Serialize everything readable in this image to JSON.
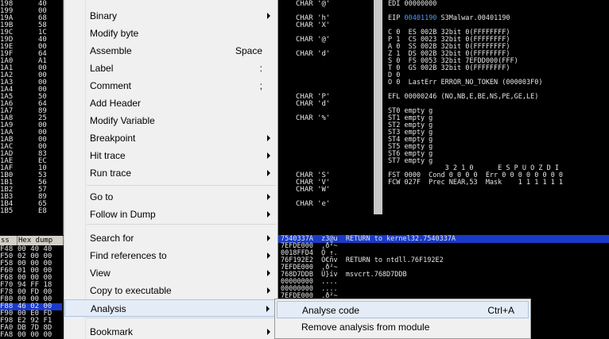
{
  "left_pane": {
    "rows": [
      {
        "addr": "198",
        "val": "40"
      },
      {
        "addr": "199",
        "val": "00"
      },
      {
        "addr": "19A",
        "val": "68"
      },
      {
        "addr": "19B",
        "val": "58"
      },
      {
        "addr": "19C",
        "val": "1C"
      },
      {
        "addr": "19D",
        "val": "40"
      },
      {
        "addr": "19E",
        "val": "00"
      },
      {
        "addr": "19F",
        "val": "64"
      },
      {
        "addr": "1A0",
        "val": "A1"
      },
      {
        "addr": "1A1",
        "val": "00"
      },
      {
        "addr": "1A2",
        "val": "00"
      },
      {
        "addr": "1A3",
        "val": "00"
      },
      {
        "addr": "1A4",
        "val": "00"
      },
      {
        "addr": "1A5",
        "val": "50"
      },
      {
        "addr": "1A6",
        "val": "64"
      },
      {
        "addr": "1A7",
        "val": "89"
      },
      {
        "addr": "1A8",
        "val": "25"
      },
      {
        "addr": "1A9",
        "val": "00"
      },
      {
        "addr": "1AA",
        "val": "00"
      },
      {
        "addr": "1AB",
        "val": "00"
      },
      {
        "addr": "1AC",
        "val": "00"
      },
      {
        "addr": "1AD",
        "val": "83"
      },
      {
        "addr": "1AE",
        "val": "EC"
      },
      {
        "addr": "1AF",
        "val": "10"
      },
      {
        "addr": "1B0",
        "val": "53"
      },
      {
        "addr": "1B1",
        "val": "56"
      },
      {
        "addr": "1B2",
        "val": "57"
      },
      {
        "addr": "1B3",
        "val": "89"
      },
      {
        "addr": "1B4",
        "val": "65"
      },
      {
        "addr": "1B5",
        "val": "E8"
      }
    ]
  },
  "dump": {
    "header": {
      "col1": "ss",
      "col2": "Hex dump"
    },
    "rows": [
      {
        "a": "F48",
        "b": "00 40 40"
      },
      {
        "a": "F50",
        "b": "02 00 00"
      },
      {
        "a": "F58",
        "b": "00 00 00"
      },
      {
        "a": "F60",
        "b": "01 00 00"
      },
      {
        "a": "F68",
        "b": "00 00 00"
      },
      {
        "a": "F70",
        "b": "94 FF 18"
      },
      {
        "a": "F78",
        "b": "00 FD 00"
      },
      {
        "a": "F80",
        "b": "00 00 00"
      },
      {
        "a": "F88",
        "b": "46 02 00",
        "selected": true
      },
      {
        "a": "F90",
        "b": "00 E0 FD"
      },
      {
        "a": "F98",
        "b": "E2 92 F1"
      },
      {
        "a": "FA0",
        "b": "DB 7D 8D"
      },
      {
        "a": "FA8",
        "b": "00 00 00"
      }
    ]
  },
  "disasm": {
    "comments": [
      {
        "text": "CHAR '@'",
        "row": 0
      },
      {
        "text": "CHAR 'h'",
        "row": 2
      },
      {
        "text": "CHAR 'X'",
        "row": 3
      },
      {
        "text": "CHAR '@'",
        "row": 5
      },
      {
        "text": "CHAR 'd'",
        "row": 7
      },
      {
        "text": "CHAR 'P'",
        "row": 13
      },
      {
        "text": "CHAR 'd'",
        "row": 14
      },
      {
        "text": "CHAR '%'",
        "row": 16
      },
      {
        "text": "CHAR 'S'",
        "row": 24
      },
      {
        "text": "CHAR 'V'",
        "row": 25
      },
      {
        "text": "CHAR 'W'",
        "row": 26
      },
      {
        "text": "CHAR 'e'",
        "row": 28
      }
    ]
  },
  "registers": {
    "lines": [
      "EDI 00000000",
      "",
      "EIP 00401190 S3Malwar.00401190",
      "",
      "C 0  ES 002B 32bit 0(FFFFFFFF)",
      "P 1  CS 0023 32bit 0(FFFFFFFF)",
      "A 0  SS 002B 32bit 0(FFFFFFFF)",
      "Z 1  DS 002B 32bit 0(FFFFFFFF)",
      "S 0  FS 0053 32bit 7EFDD000(FFF)",
      "T 0  GS 002B 32bit 0(FFFFFFFF)",
      "D 0",
      "O 0  LastErr ERROR_NO_TOKEN (000003F0)",
      "",
      "EFL 00000246 (NO,NB,E,BE,NS,PE,GE,LE)",
      "",
      "ST0 empty g",
      "ST1 empty g",
      "ST2 empty g",
      "ST3 empty g",
      "ST4 empty g",
      "ST5 empty g",
      "ST6 empty g",
      "ST7 empty g",
      "              3 2 1 0      E S P U O Z D I",
      "FST 0000  Cond 0 0 0 0  Err 0 0 0 0 0 0 0 0",
      "FCW 027F  Prec NEAR,53  Mask    1 1 1 1 1 1"
    ],
    "eip_value": "00401190"
  },
  "stack": {
    "lines": [
      "7540337A  z3@u  RETURN to kernel32.7540337A",
      "7EFDE000  .ð²~",
      "0018FFD4  Ô ↑.",
      "76F192E2  Ò€ñv  RETURN to ntdll.76F192E2",
      "7EFDE000  .ð²~",
      "768D7DDB  Û}ív  msvcrt.768D7DDB",
      "00000000  ....",
      "00000000  ....",
      "7EFDE000  .ð²~"
    ]
  },
  "context_menu": {
    "items": [
      {
        "label": "Binary",
        "shortcut": "",
        "submenu": true
      },
      {
        "label": "Modify byte",
        "shortcut": "",
        "submenu": false
      },
      {
        "label": "Assemble",
        "shortcut": "Space",
        "submenu": false
      },
      {
        "label": "Label",
        "shortcut": ":",
        "submenu": false
      },
      {
        "label": "Comment",
        "shortcut": ";",
        "submenu": false
      },
      {
        "label": "Add Header",
        "shortcut": "",
        "submenu": false
      },
      {
        "label": "Modify Variable",
        "shortcut": "",
        "submenu": false
      },
      {
        "label": "Breakpoint",
        "shortcut": "",
        "submenu": true
      },
      {
        "label": "Hit trace",
        "shortcut": "",
        "submenu": true
      },
      {
        "label": "Run trace",
        "shortcut": "",
        "submenu": true
      },
      {
        "label": "Go to",
        "shortcut": "",
        "submenu": true
      },
      {
        "label": "Follow in Dump",
        "shortcut": "",
        "submenu": true
      },
      {
        "label": "Search for",
        "shortcut": "",
        "submenu": true
      },
      {
        "label": "Find references to",
        "shortcut": "",
        "submenu": true
      },
      {
        "label": "View",
        "shortcut": "",
        "submenu": true
      },
      {
        "label": "Copy to executable",
        "shortcut": "",
        "submenu": true
      },
      {
        "label": "Analysis",
        "shortcut": "",
        "submenu": true,
        "highlighted": true
      },
      {
        "label": "Bookmark",
        "shortcut": "",
        "submenu": true
      }
    ]
  },
  "submenu": {
    "items": [
      {
        "label": "Analyse code",
        "shortcut": "Ctrl+A",
        "highlighted": true
      },
      {
        "label": "Remove analysis from module",
        "shortcut": ""
      }
    ]
  },
  "colors": {
    "selection": "#1a3ac8",
    "menu_bg": "#f0f0f0",
    "highlight": "#e4ecf7",
    "eip_blue": "#4a9cff"
  }
}
